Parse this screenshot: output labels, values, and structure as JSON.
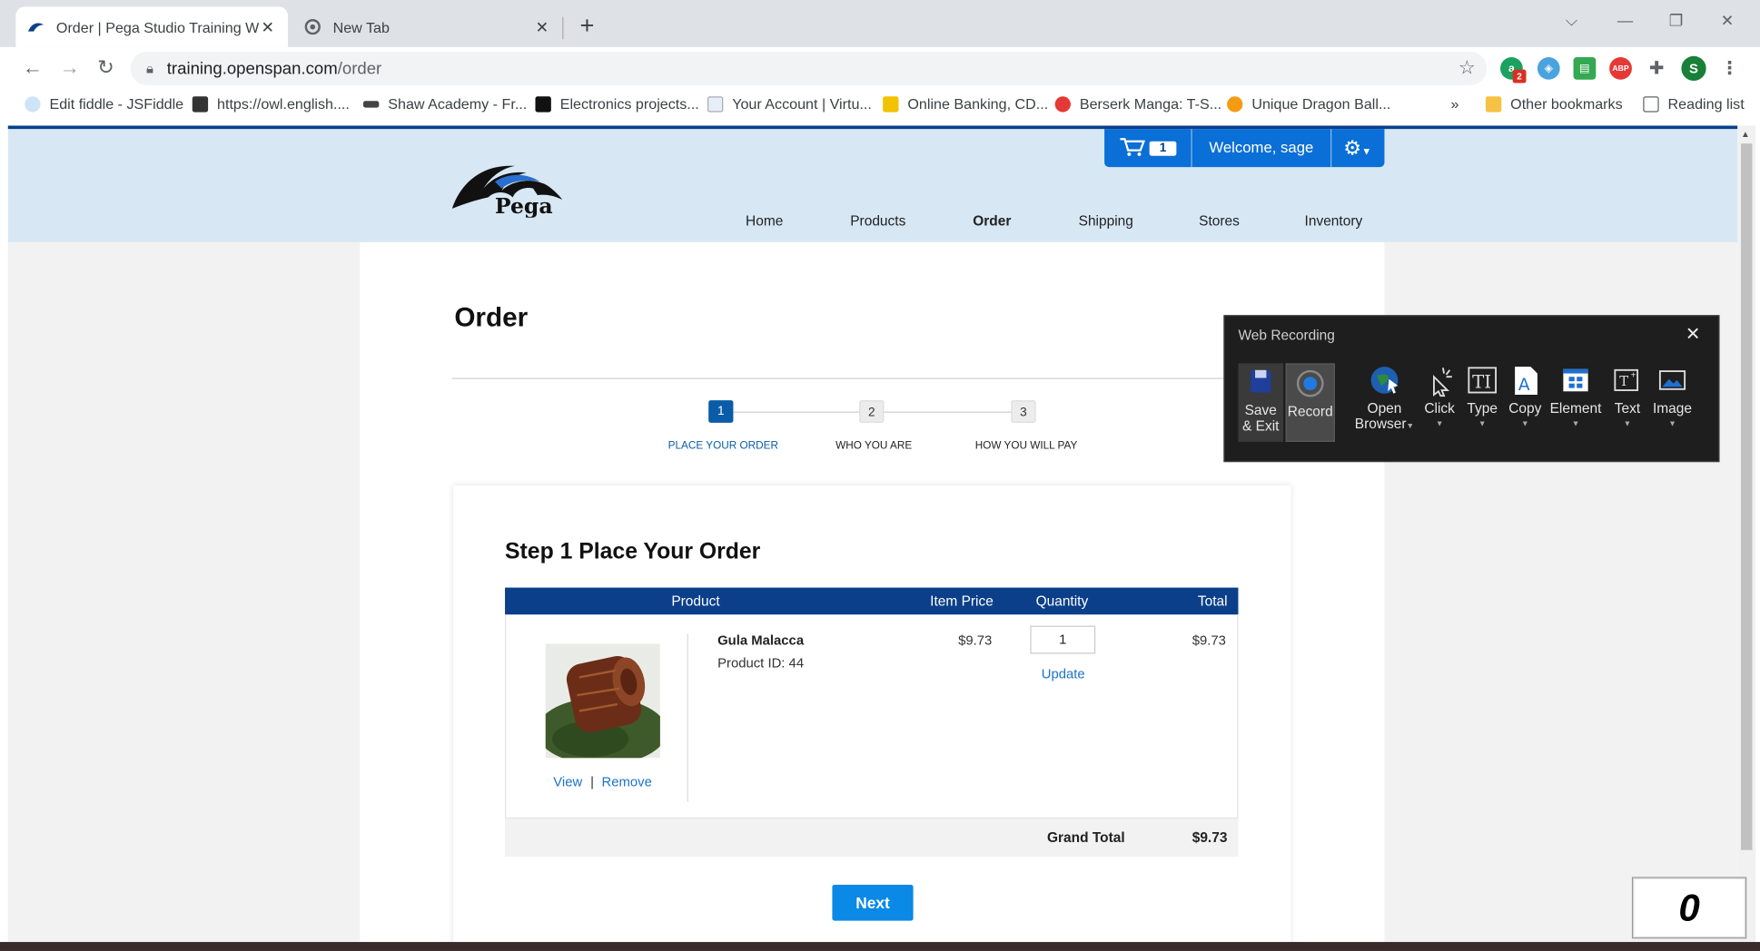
{
  "browser": {
    "tabs": [
      {
        "title": "Order | Pega Studio Training Web",
        "active": true
      },
      {
        "title": "New Tab",
        "active": false
      }
    ],
    "url_host": "training.openspan.com",
    "url_path": "/order",
    "bookmarks": [
      "Edit fiddle - JSFiddle",
      "https://owl.english....",
      "Shaw Academy - Fr...",
      "Electronics projects...",
      "Your Account | Virtu...",
      "Online Banking, CD...",
      "Berserk Manga: T-S...",
      "Unique Dragon Ball..."
    ],
    "bookmarks_overflow": "»",
    "other_bookmarks": "Other bookmarks",
    "reading_list": "Reading list",
    "ext_badge": "2",
    "profile_initial": "S"
  },
  "site": {
    "logo_text": "Pega",
    "cart_count": "1",
    "welcome": "Welcome, sage",
    "nav": [
      "Home",
      "Products",
      "Order",
      "Shipping",
      "Stores",
      "Inventory"
    ],
    "active_nav": "Order"
  },
  "order": {
    "title": "Order",
    "steps": [
      {
        "num": "1",
        "label": "PLACE YOUR ORDER"
      },
      {
        "num": "2",
        "label": "WHO YOU ARE"
      },
      {
        "num": "3",
        "label": "HOW YOU WILL PAY"
      }
    ],
    "card_title": "Step 1 Place Your Order",
    "columns": {
      "product": "Product",
      "item_price": "Item Price",
      "quantity": "Quantity",
      "total": "Total"
    },
    "item": {
      "name": "Gula Malacca",
      "product_id": "Product ID: 44",
      "price": "$9.73",
      "quantity": "1",
      "total": "$9.73",
      "update": "Update",
      "view": "View",
      "separator": "|",
      "remove": "Remove"
    },
    "grand_total_label": "Grand Total",
    "grand_total": "$9.73",
    "next": "Next"
  },
  "web_recording": {
    "title": "Web Recording",
    "buttons": {
      "save_exit_1": "Save",
      "save_exit_2": "& Exit",
      "record": "Record",
      "open_1": "Open",
      "open_2": "Browser",
      "click": "Click",
      "type": "Type",
      "copy": "Copy",
      "element": "Element",
      "text": "Text",
      "image": "Image"
    }
  },
  "counter": "0"
}
